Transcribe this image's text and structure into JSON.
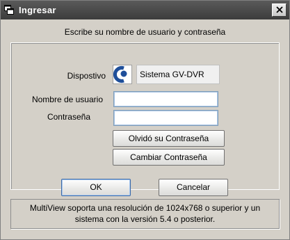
{
  "window": {
    "title": "Ingresar",
    "title_icon": "windows-stack-icon",
    "close_icon": "close-icon"
  },
  "instruction": "Escribe su nombre de usuario y contraseña",
  "form": {
    "device_label": "Dispostivo",
    "device_name": "Sistema GV-DVR",
    "device_icon": "geovision-logo-icon",
    "username_label": "Nombre de usuario",
    "username_value": "",
    "password_label": "Contraseña",
    "password_value": ""
  },
  "buttons": {
    "forgot_password": "Olvidó su Contraseña",
    "change_password": "Cambiar Contraseña",
    "ok": "OK",
    "cancel": "Cancelar"
  },
  "info": {
    "line1": "MultiView soporta una resolución de 1024x768 o superior y un",
    "line2": "sistema con la versión 5.4 o posterior."
  },
  "colors": {
    "titlebar": "#4a4a4a",
    "dialog_bg": "#d4d0c8",
    "textbox_border": "#7f9db9",
    "logo_blue": "#1f4f9a"
  }
}
